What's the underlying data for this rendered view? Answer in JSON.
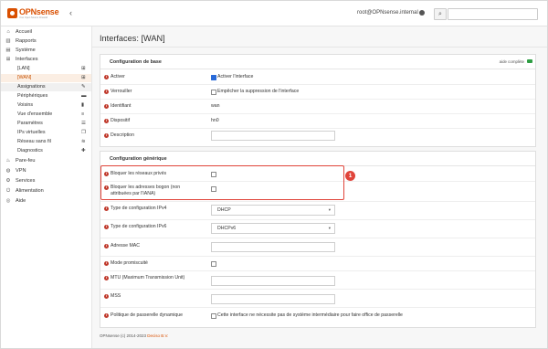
{
  "header": {
    "logo_text": "OPNsense",
    "logo_sub": "Your Open Source Firewall",
    "user": "root@OPNsense.internal"
  },
  "sidebar": {
    "top": [
      {
        "label": "Accueil",
        "icon": "home-icon"
      },
      {
        "label": "Rapports",
        "icon": "chart-icon"
      },
      {
        "label": "Système",
        "icon": "server-icon"
      },
      {
        "label": "Interfaces",
        "icon": "sitemap-icon"
      }
    ],
    "sub": [
      {
        "label": "[LAN]",
        "icon": "sitemap-icon"
      },
      {
        "label": "[WAN]",
        "icon": "sitemap-icon"
      },
      {
        "label": "Assignations",
        "icon": "pencil-icon"
      },
      {
        "label": "Périphériques",
        "icon": "hdd-icon"
      },
      {
        "label": "Voisins",
        "icon": "book-icon"
      },
      {
        "label": "Vue d'ensemble",
        "icon": "list-icon"
      },
      {
        "label": "Paramètres",
        "icon": "sliders-icon"
      },
      {
        "label": "IPs virtuelles",
        "icon": "clone-icon"
      },
      {
        "label": "Réseau sans fil",
        "icon": "wifi-icon"
      },
      {
        "label": "Diagnostics",
        "icon": "medkit-icon"
      }
    ],
    "bottom": [
      {
        "label": "Pare-feu",
        "icon": "fire-icon"
      },
      {
        "label": "VPN",
        "icon": "globe-icon"
      },
      {
        "label": "Services",
        "icon": "cog-icon"
      },
      {
        "label": "Alimentation",
        "icon": "plug-icon"
      },
      {
        "label": "Aide",
        "icon": "support-icon"
      }
    ]
  },
  "page": {
    "title": "Interfaces: [WAN]"
  },
  "basic": {
    "title": "Configuration de base",
    "help_label": "aide complète",
    "enable_label": "Activer",
    "enable_text": "Activer l'interface",
    "lock_label": "Verrouiller",
    "lock_text": "Empêcher la suppression de l'interface",
    "id_label": "Identifiant",
    "id_value": "wan",
    "device_label": "Dispositif",
    "device_value": "hn0",
    "desc_label": "Description",
    "desc_value": ""
  },
  "generic": {
    "title": "Configuration générique",
    "block_private_label": "Bloquer les réseaux privés",
    "block_bogon_label": "Bloquer les adresses bogon (non attribuées par l'IANA)",
    "ipv4_type_label": "Type de configuration IPv4",
    "ipv4_type_value": "DHCP",
    "ipv6_type_label": "Type de configuration IPv6",
    "ipv6_type_value": "DHCPv6",
    "mac_label": "Adresse MAC",
    "promisc_label": "Mode promiscuité",
    "mtu_label": "MTU (Maximum Transmission Unit)",
    "mss_label": "MSS",
    "gateway_label": "Politique de passerelle dynamique",
    "gateway_text": "Cette interface ne nécessite pas de système intermédiaire pour faire office de passerelle"
  },
  "callout": {
    "number": "1"
  },
  "footer": {
    "text": "OPNsense (c) 2014-2023",
    "brand": "Deciso B.V."
  },
  "colors": {
    "accent": "#d94f00",
    "highlight": "#e0443a",
    "info": "#c0392b"
  }
}
